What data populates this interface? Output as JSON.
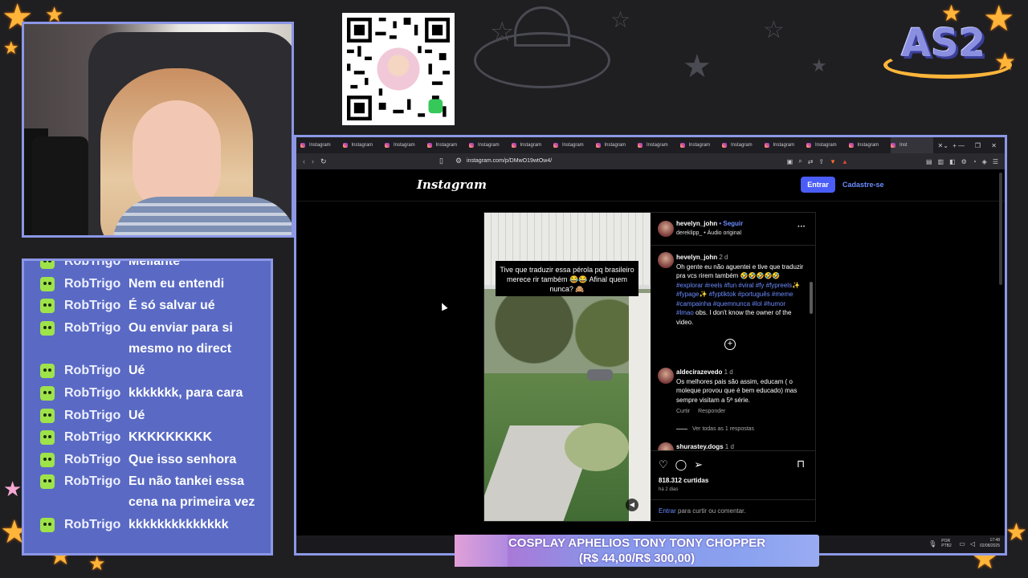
{
  "logo": {
    "text": "AS2"
  },
  "chat": {
    "messages": [
      {
        "user": "RobTrigo",
        "text": "Meliante"
      },
      {
        "user": "RobTrigo",
        "text": "Nem eu entendi"
      },
      {
        "user": "RobTrigo",
        "text": "É só salvar ué"
      },
      {
        "user": "RobTrigo",
        "text": "Ou enviar para si mesmo no direct"
      },
      {
        "user": "RobTrigo",
        "text": "Ué"
      },
      {
        "user": "RobTrigo",
        "text": "kkkkkkk, para cara"
      },
      {
        "user": "RobTrigo",
        "text": "Ué"
      },
      {
        "user": "RobTrigo",
        "text": "KKKKKKKKK"
      },
      {
        "user": "RobTrigo",
        "text": "Que isso senhora"
      },
      {
        "user": "RobTrigo",
        "text": "Eu não tankei essa cena na primeira vez"
      },
      {
        "user": "RobTrigo",
        "text": "kkkkkkkkkkkkkk"
      }
    ]
  },
  "browser": {
    "tabs": [
      "Instagram",
      "Instagram",
      "Instagram",
      "Instagram",
      "Instagram",
      "Instagram",
      "Instagram",
      "Instagram",
      "Instagram",
      "Instagram",
      "Instagram",
      "Instagram",
      "Instagram",
      "Instagram",
      "Inst"
    ],
    "url": "instagram.com/p/DMwO19wtOw4/",
    "taskbar": {
      "lang": "POR PTB2",
      "time": "17:48",
      "date": "02/08/2025"
    }
  },
  "instagram": {
    "logo": "Instagram",
    "login": "Entrar",
    "signup": "Cadastre-se",
    "post": {
      "video_caption": "Tive que traduzir essa pérola pq brasileiro merece rir também 😂😂 Afinal quem nunca? 🙈",
      "author": "hevelyn_john",
      "follow": " • Seguir",
      "audio": "dereklipp_ • Áudio original",
      "caption_user": "hevelyn_john",
      "caption_time": "2 d",
      "caption_text": "Oh gente eu não aguentei e tive que traduzir pra vcs rirem também 🤣🤣🤣🤣🤣",
      "caption_tags": "#explorar #reels #fun #viral #fy #fypreels✨ #fypage✨ #fyptiktok #português #meme #campainha #quemnunca #lol #humor #lmao",
      "caption_tail": " obs. I don't know the owner of the video.",
      "comment1_user": "aldecirazevedo",
      "comment1_time": "1 d",
      "comment1_text": "Os melhores pais são assim, educam ( o moleque provou que é bem educado) mas sempre visitam a 5ª série.",
      "comment1_like": "Curtir",
      "comment1_reply": "Responder",
      "comment1_replies": "Ver todas as 1 respostas",
      "comment2_user": "shurastey.dogs",
      "comment2_time": "1 d",
      "likes": "818.312 curtidas",
      "ago": "há 2 dias",
      "login_prompt_link": "Entrar",
      "login_prompt_text": " para curtir ou comentar."
    }
  },
  "banner": {
    "line1": "COSPLAY APHELIOS TONY TONY CHOPPER",
    "line2": "(R$ 44,00/R$ 300,00)"
  }
}
